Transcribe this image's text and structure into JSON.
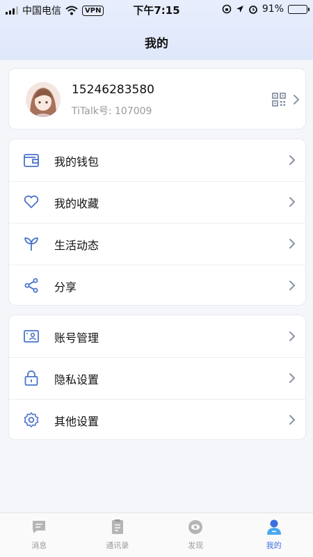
{
  "status_bar": {
    "carrier": "中国电信",
    "vpn": "VPN",
    "time": "下午7:15",
    "battery_text": "91%",
    "battery_level": 0.91
  },
  "header": {
    "title": "我的"
  },
  "profile": {
    "phone": "15246283580",
    "titalk_id": "TiTalk号: 107009"
  },
  "menu_group_1": [
    {
      "label": "我的钱包",
      "icon": "wallet-icon"
    },
    {
      "label": "我的收藏",
      "icon": "heart-icon"
    },
    {
      "label": "生活动态",
      "icon": "sprout-icon"
    },
    {
      "label": "分享",
      "icon": "share-icon"
    }
  ],
  "menu_group_2": [
    {
      "label": "账号管理",
      "icon": "id-card-icon"
    },
    {
      "label": "隐私设置",
      "icon": "lock-icon"
    },
    {
      "label": "其他设置",
      "icon": "gear-icon"
    }
  ],
  "tabs": [
    {
      "label": "消息",
      "icon": "message-icon",
      "active": false
    },
    {
      "label": "通讯录",
      "icon": "contacts-icon",
      "active": false
    },
    {
      "label": "发现",
      "icon": "discover-icon",
      "active": false
    },
    {
      "label": "我的",
      "icon": "user-icon",
      "active": true
    }
  ],
  "colors": {
    "accent": "#3b6fe0",
    "icon_blue": "#4a73c9",
    "inactive_tab": "#9a9a9a"
  }
}
